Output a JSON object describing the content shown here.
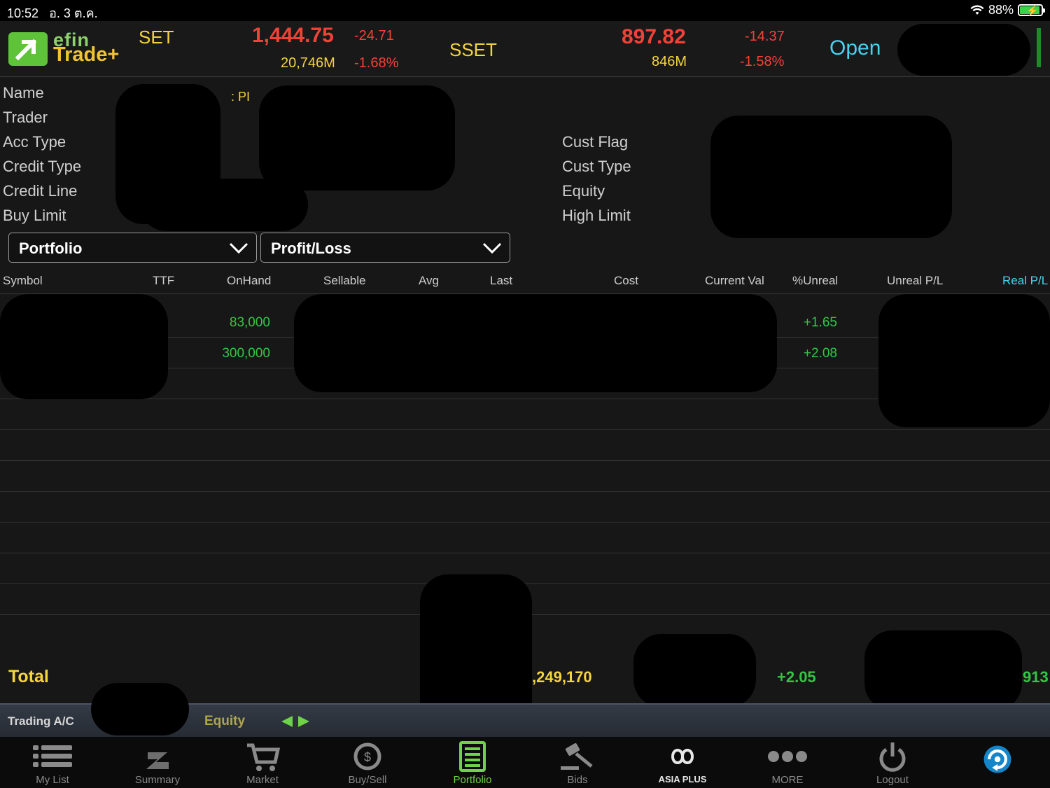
{
  "status_bar": {
    "time": "10:52",
    "date": "อ. 3 ต.ค.",
    "battery": "88%"
  },
  "header": {
    "brand_top": "efin",
    "brand_bottom": "Trade+",
    "set": {
      "name": "SET",
      "value": "1,444.75",
      "change": "-24.71",
      "volume": "20,746M",
      "percent": "-1.68%"
    },
    "sset": {
      "name": "SSET",
      "value": "897.82",
      "change": "-14.37",
      "volume": "846M",
      "percent": "-1.58%"
    },
    "market_status": "Open"
  },
  "account": {
    "left_labels": [
      "Name",
      "Trader",
      "Acc Type",
      "Credit Type",
      "Credit Line",
      "Buy Limit"
    ],
    "right_labels": [
      "Cust Flag",
      "Cust Type",
      "Equity",
      "High Limit"
    ],
    "name_value": ":  PI"
  },
  "dropdowns": {
    "view": "Portfolio",
    "mode": "Profit/Loss"
  },
  "table": {
    "headers": [
      "Symbol",
      "TTF",
      "OnHand",
      "Sellable",
      "Avg",
      "Last",
      "Cost",
      "Current Val",
      "%Unreal",
      "Unreal P/L",
      "Real P/L"
    ],
    "rows": [
      {
        "onhand": "83,000",
        "unreal_pct": "+1.65"
      },
      {
        "onhand": "300,000",
        "unreal_pct": "+2.08"
      }
    ]
  },
  "total": {
    "label": "Total",
    "cost_partial": ",249,170",
    "unreal_pct": "+2.05",
    "real_partial": "913"
  },
  "trading_bar": {
    "account_label": "Trading A/C",
    "account_type": "Equity"
  },
  "tabs": [
    "My List",
    "Summary",
    "Market",
    "Buy/Sell",
    "Portfolio",
    "Bids",
    "ASIA PLUS",
    "MORE",
    "Logout"
  ],
  "active_tab": "Portfolio",
  "colors": {
    "up": "#36c447",
    "down": "#f24238",
    "highlight": "#f5d43d",
    "accent": "#47d3f0"
  }
}
